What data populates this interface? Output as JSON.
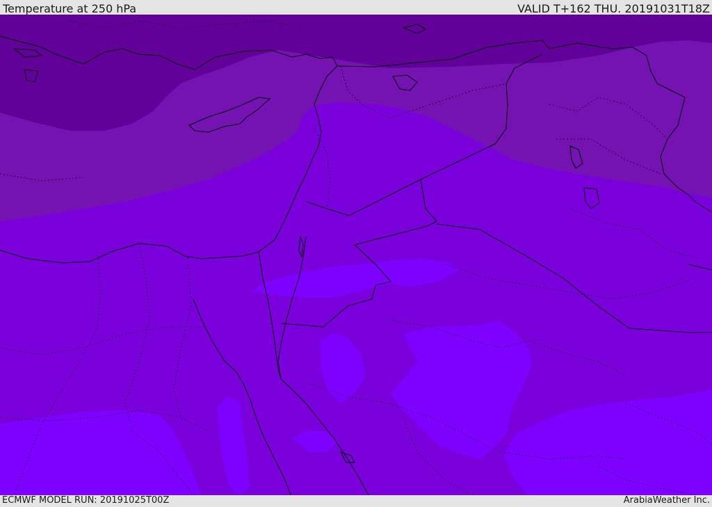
{
  "header": {
    "title": "Temperature at 250 hPa",
    "valid_time": "VALID T+162 THU. 20191031T18Z"
  },
  "footer": {
    "model_run": "ECMWF MODEL RUN: 20191025T00Z",
    "credit": "ArabiaWeather Inc."
  },
  "map": {
    "variable": "temperature",
    "pressure_level_hpa": 250,
    "colors": {
      "coldest_band": "#62009a",
      "cold_band": "#7412b2",
      "mid_band": "#7a00dc",
      "warm_band": "#7e00ff",
      "coastline": "#000000",
      "border_lines": "#1a0030"
    }
  }
}
